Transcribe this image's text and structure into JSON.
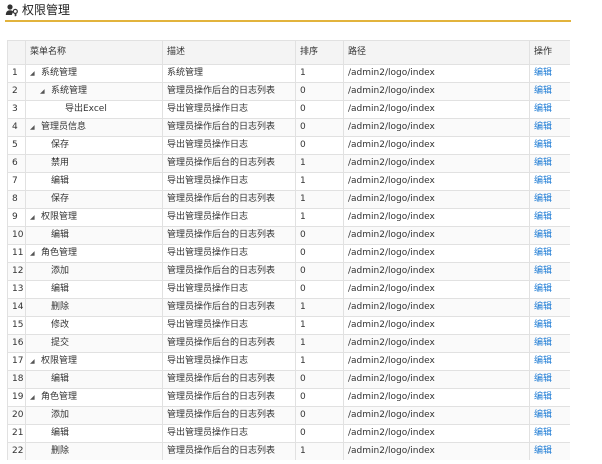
{
  "header": {
    "title": "权限管理"
  },
  "table": {
    "columns": [
      "",
      "菜单名称",
      "描述",
      "排序",
      "路径",
      "操作"
    ],
    "rows": [
      {
        "no": "1",
        "toggle": "◢",
        "level": 0,
        "name": "系统管理",
        "desc": "系统管理",
        "sort": "1",
        "path": "/admin2/logo/index",
        "action": "编辑"
      },
      {
        "no": "2",
        "toggle": "◢",
        "level": 1,
        "name": "系统管理",
        "desc": "管理员操作后台的日志列表",
        "sort": "0",
        "path": "/admin2/logo/index",
        "action": "编辑"
      },
      {
        "no": "3",
        "toggle": "",
        "level": 2,
        "name": "导出Excel",
        "desc": "导出管理员操作日志",
        "sort": "0",
        "path": "/admin2/logo/index",
        "action": "编辑"
      },
      {
        "no": "4",
        "toggle": "◢",
        "level": 0,
        "name": "管理员信息",
        "desc": "管理员操作后台的日志列表",
        "sort": "0",
        "path": "/admin2/logo/index",
        "action": "编辑"
      },
      {
        "no": "5",
        "toggle": "",
        "level": 1,
        "name": "保存",
        "desc": "导出管理员操作日志",
        "sort": "0",
        "path": "/admin2/logo/index",
        "action": "编辑"
      },
      {
        "no": "6",
        "toggle": "",
        "level": 1,
        "name": "禁用",
        "desc": "管理员操作后台的日志列表",
        "sort": "1",
        "path": "/admin2/logo/index",
        "action": "编辑"
      },
      {
        "no": "7",
        "toggle": "",
        "level": 1,
        "name": "编辑",
        "desc": "导出管理员操作日志",
        "sort": "1",
        "path": "/admin2/logo/index",
        "action": "编辑"
      },
      {
        "no": "8",
        "toggle": "",
        "level": 1,
        "name": "保存",
        "desc": "管理员操作后台的日志列表",
        "sort": "1",
        "path": "/admin2/logo/index",
        "action": "编辑"
      },
      {
        "no": "9",
        "toggle": "◢",
        "level": 0,
        "name": "权限管理",
        "desc": "导出管理员操作日志",
        "sort": "1",
        "path": "/admin2/logo/index",
        "action": "编辑"
      },
      {
        "no": "10",
        "toggle": "",
        "level": 1,
        "name": "编辑",
        "desc": "管理员操作后台的日志列表",
        "sort": "0",
        "path": "/admin2/logo/index",
        "action": "编辑"
      },
      {
        "no": "11",
        "toggle": "◢",
        "level": 0,
        "name": "角色管理",
        "desc": "导出管理员操作日志",
        "sort": "0",
        "path": "/admin2/logo/index",
        "action": "编辑"
      },
      {
        "no": "12",
        "toggle": "",
        "level": 1,
        "name": "添加",
        "desc": "管理员操作后台的日志列表",
        "sort": "0",
        "path": "/admin2/logo/index",
        "action": "编辑"
      },
      {
        "no": "13",
        "toggle": "",
        "level": 1,
        "name": "编辑",
        "desc": "导出管理员操作日志",
        "sort": "0",
        "path": "/admin2/logo/index",
        "action": "编辑"
      },
      {
        "no": "14",
        "toggle": "",
        "level": 1,
        "name": "删除",
        "desc": "管理员操作后台的日志列表",
        "sort": "1",
        "path": "/admin2/logo/index",
        "action": "编辑"
      },
      {
        "no": "15",
        "toggle": "",
        "level": 1,
        "name": "修改",
        "desc": "导出管理员操作日志",
        "sort": "1",
        "path": "/admin2/logo/index",
        "action": "编辑"
      },
      {
        "no": "16",
        "toggle": "",
        "level": 1,
        "name": "提交",
        "desc": "管理员操作后台的日志列表",
        "sort": "1",
        "path": "/admin2/logo/index",
        "action": "编辑"
      },
      {
        "no": "17",
        "toggle": "◢",
        "level": 0,
        "name": "权限管理",
        "desc": "导出管理员操作日志",
        "sort": "1",
        "path": "/admin2/logo/index",
        "action": "编辑"
      },
      {
        "no": "18",
        "toggle": "",
        "level": 1,
        "name": "编辑",
        "desc": "管理员操作后台的日志列表",
        "sort": "0",
        "path": "/admin2/logo/index",
        "action": "编辑"
      },
      {
        "no": "19",
        "toggle": "◢",
        "level": 0,
        "name": "角色管理",
        "desc": "管理员操作后台的日志列表",
        "sort": "0",
        "path": "/admin2/logo/index",
        "action": "编辑"
      },
      {
        "no": "20",
        "toggle": "",
        "level": 1,
        "name": "添加",
        "desc": "管理员操作后台的日志列表",
        "sort": "0",
        "path": "/admin2/logo/index",
        "action": "编辑"
      },
      {
        "no": "21",
        "toggle": "",
        "level": 1,
        "name": "编辑",
        "desc": "导出管理员操作日志",
        "sort": "0",
        "path": "/admin2/logo/index",
        "action": "编辑"
      },
      {
        "no": "22",
        "toggle": "",
        "level": 1,
        "name": "删除",
        "desc": "管理员操作后台的日志列表",
        "sort": "1",
        "path": "/admin2/logo/index",
        "action": "编辑"
      }
    ]
  },
  "colors": {
    "accent_line": "#e2b33c",
    "link": "#1b7ad4",
    "header_bg": "#f4f4f4",
    "border": "#e1e1e1"
  },
  "icons": {
    "page_icon": "users-key-icon",
    "toggle": "triangle-collapse-icon"
  }
}
